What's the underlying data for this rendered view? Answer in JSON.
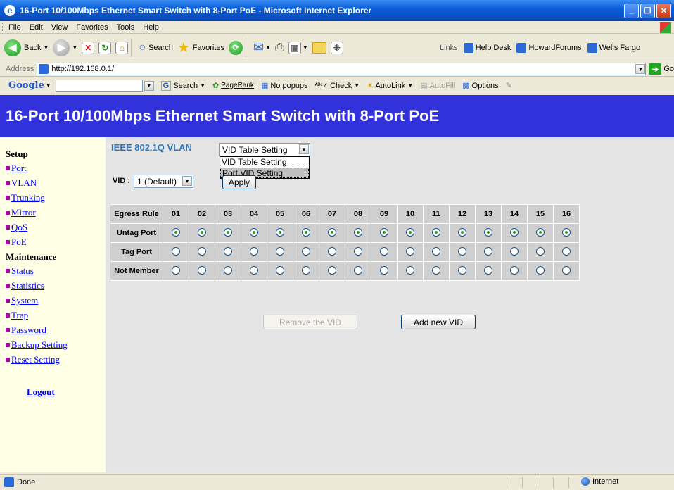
{
  "window": {
    "title": "16-Port 10/100Mbps Ethernet Smart Switch with 8-Port PoE - Microsoft Internet Explorer"
  },
  "menu": {
    "items": [
      "File",
      "Edit",
      "View",
      "Favorites",
      "Tools",
      "Help"
    ]
  },
  "toolbar": {
    "back_label": "Back",
    "search_label": "Search",
    "favorites_label": "Favorites",
    "links_label": "Links",
    "links": [
      "Help Desk",
      "HowardForums",
      "Wells Fargo"
    ]
  },
  "address": {
    "label": "Address",
    "url": "http://192.168.0.1/",
    "go_label": "Go"
  },
  "googlebar": {
    "logo": "Google",
    "search_label": "Search",
    "pagerank": "PageRank",
    "popups": "No popups",
    "check": "Check",
    "autolink": "AutoLink",
    "autofill": "AutoFill",
    "options": "Options"
  },
  "page": {
    "header": "16-Port 10/100Mbps Ethernet Smart Switch with 8-Port PoE"
  },
  "sidebar": {
    "setup_heading": "Setup",
    "setup_items": [
      "Port",
      "VLAN",
      "Trunking",
      "Mirror",
      "QoS",
      "PoE"
    ],
    "maintenance_heading": "Maintenance",
    "maintenance_items": [
      "Status",
      "Statistics",
      "System",
      "Trap",
      "Password",
      "Backup Setting",
      "Reset Setting"
    ],
    "logout": "Logout"
  },
  "main": {
    "title": "IEEE 802.1Q VLAN",
    "mode_select": {
      "value": "VID Table Setting",
      "options": [
        "VID Table Setting",
        "Port VID Setting"
      ],
      "highlighted": "Port VID Setting"
    },
    "vid_label": "VID :",
    "vid_select": "1 (Default)",
    "apply_label": "Apply",
    "table": {
      "header_label": "Egress Rule",
      "ports": [
        "01",
        "02",
        "03",
        "04",
        "05",
        "06",
        "07",
        "08",
        "09",
        "10",
        "11",
        "12",
        "13",
        "14",
        "15",
        "16"
      ],
      "rows": [
        {
          "label": "Untag Port",
          "selected": true
        },
        {
          "label": "Tag Port",
          "selected": false
        },
        {
          "label": "Not Member",
          "selected": false
        }
      ]
    },
    "remove_label": "Remove the VID",
    "add_label": "Add new VID"
  },
  "status": {
    "text": "Done",
    "zone": "Internet"
  }
}
